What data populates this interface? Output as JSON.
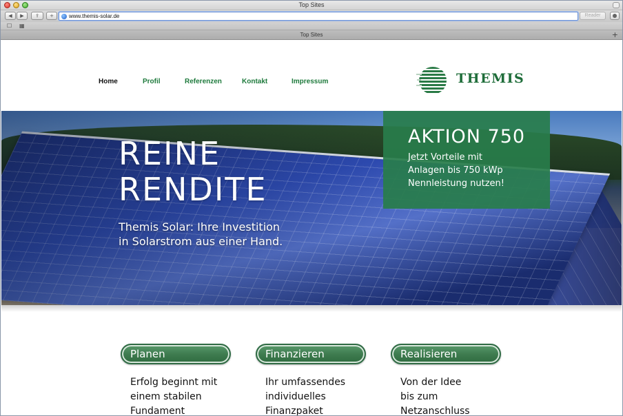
{
  "window": {
    "title": "Top Sites"
  },
  "toolbar": {
    "url": "www.themis-solar.de",
    "reader_label": "Reader"
  },
  "tab": {
    "title": "Top Sites"
  },
  "nav": {
    "items": [
      {
        "label": "Home",
        "active": true
      },
      {
        "label": "Profil"
      },
      {
        "label": "Referenzen"
      },
      {
        "label": "Kontakt"
      },
      {
        "label": "Impressum"
      }
    ]
  },
  "logo": {
    "text": "THEMIS"
  },
  "hero": {
    "headline_line1": "REINE",
    "headline_line2": "RENDITE",
    "sub_line1": "Themis Solar: Ihre Investition",
    "sub_line2": "in Solarstrom aus einer Hand."
  },
  "promo": {
    "title": "AKTION 750",
    "line1": "Jetzt Vorteile mit",
    "line2": "Anlagen bis 750 kWp",
    "line3": "Nennleistung nutzen!"
  },
  "features": [
    {
      "button": "Planen",
      "line1": "Erfolg beginnt mit",
      "line2": "einem stabilen",
      "line3": "Fundament"
    },
    {
      "button": "Finanzieren",
      "line1": "Ihr umfassendes",
      "line2": "individuelles",
      "line3": "Finanzpaket"
    },
    {
      "button": "Realisieren",
      "line1": "Von der Idee",
      "line2": "bis zum",
      "line3": "Netzanschluss"
    }
  ],
  "colors": {
    "brand_green": "#1f6d3a",
    "nav_green": "#1e7a3c",
    "promo_green": "#287d4b"
  },
  "icons": [
    "close-window-icon",
    "minimize-window-icon",
    "zoom-window-icon",
    "back-icon",
    "forward-icon",
    "share-icon",
    "add-bookmark-icon",
    "globe-icon",
    "download-icon",
    "reading-list-icon",
    "top-sites-grid-icon",
    "new-tab-icon"
  ]
}
